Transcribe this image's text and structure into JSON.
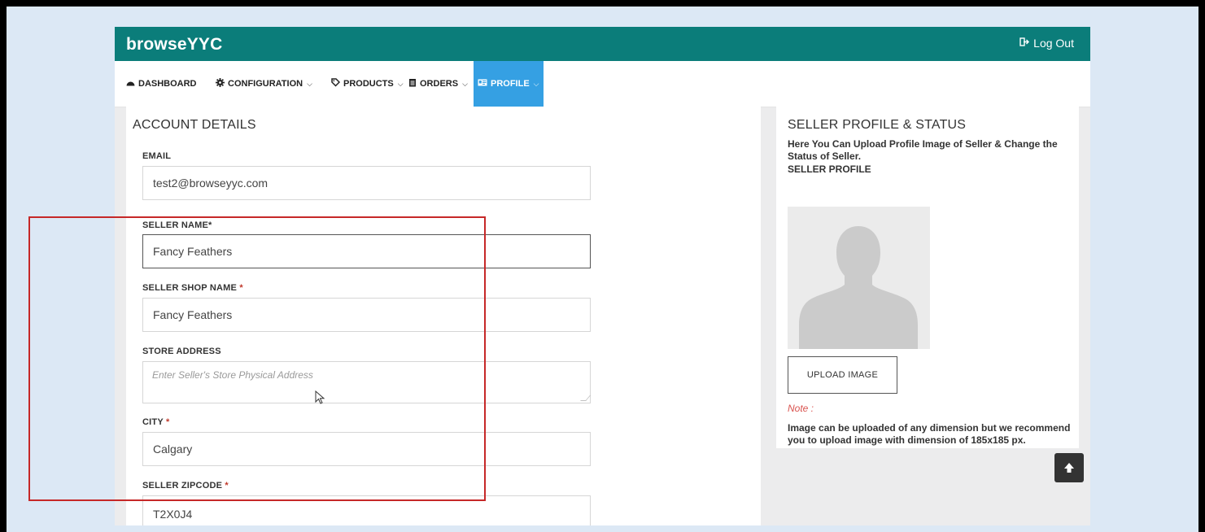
{
  "header": {
    "brand": "browseYYC",
    "logout_label": "Log Out",
    "logout_icon": "log-out-icon"
  },
  "nav": {
    "items": [
      {
        "label": "DASHBOARD",
        "icon": "dashboard-icon",
        "has_dropdown": false
      },
      {
        "label": "CONFIGURATION",
        "icon": "gear-icon",
        "has_dropdown": true
      },
      {
        "label": "PRODUCTS",
        "icon": "tag-icon",
        "has_dropdown": true
      },
      {
        "label": "ORDERS",
        "icon": "clipboard-icon",
        "has_dropdown": true
      },
      {
        "label": "PROFILE",
        "icon": "id-card-icon",
        "has_dropdown": true,
        "active": true
      }
    ]
  },
  "account": {
    "title": "ACCOUNT DETAILS",
    "email_label": "EMAIL",
    "email_value": "test2@browseyyc.com",
    "seller_name_label": "SELLER NAME*",
    "seller_name_value": "Fancy Feathers",
    "shop_name_label": "SELLER SHOP NAME",
    "shop_name_required": "*",
    "shop_name_value": "Fancy Feathers",
    "address_label": "STORE ADDRESS",
    "address_placeholder": "Enter Seller's Store Physical Address",
    "city_label": "CITY",
    "city_required": "*",
    "city_value": "Calgary",
    "zip_label": "SELLER ZIPCODE",
    "zip_required": "*",
    "zip_value": "T2X0J4"
  },
  "profile": {
    "title": "SELLER PROFILE & STATUS",
    "description": "Here You Can Upload Profile Image of Seller & Change the Status of Seller.",
    "subheading": "SELLER PROFILE",
    "upload_label": "UPLOAD IMAGE",
    "note_label": "Note :",
    "note_text": "Image can be uploaded of any dimension but we recommend you to upload image with dimension of 185x185 px."
  },
  "colors": {
    "topbar": "#0b7d7a",
    "active_nav": "#35a0e3",
    "highlight": "#c62828",
    "required": "#c0392b"
  }
}
